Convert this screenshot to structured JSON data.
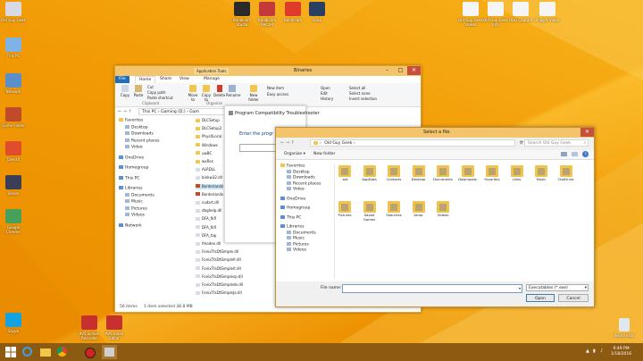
{
  "desktop_icons_left": [
    {
      "label": "Old Guy Geek",
      "color": "#d9d9e6"
    },
    {
      "label": "This PC",
      "color": "#7fb2e5"
    },
    {
      "label": "Network",
      "color": "#5a8fc7"
    },
    {
      "label": "Game Folder",
      "color": "#c04a2a"
    },
    {
      "label": "DirectX",
      "color": "#e04c2c"
    },
    {
      "label": "Steam",
      "color": "#3a3f55"
    },
    {
      "label": "Google Chrome",
      "color": "#47a15a"
    },
    {
      "label": "Skype",
      "color": "#14a3e0"
    }
  ],
  "desktop_icons_top": [
    {
      "label": "Bandicam Studio",
      "color": "#2a2a2a"
    },
    {
      "label": "Bandicam Record",
      "color": "#c43a3a"
    },
    {
      "label": "Bandicam",
      "color": "#e03a2a"
    },
    {
      "label": "Snap",
      "color": "#2a4060"
    },
    {
      "label": "Old Guy Geek Videos",
      "color": "#f5f5f5"
    },
    {
      "label": "Old Guy Geek Info",
      "color": "#f5f5f5"
    },
    {
      "label": "OGG Capture",
      "color": "#f5f5f5"
    },
    {
      "label": "Snag-it Video",
      "color": "#f5f5f5"
    }
  ],
  "desktop_icons_bottom": [
    {
      "label": "AVS Screen Recorder",
      "color": "#c83030"
    },
    {
      "label": "AVS Video Editor",
      "color": "#c83030"
    }
  ],
  "recycle_bin": "Recycle Bin",
  "explorer": {
    "title": "Binaries",
    "app_tools_tab": "Application Tools",
    "tabs": [
      "File",
      "Home",
      "Share",
      "View",
      "Manage"
    ],
    "ribbon_buttons": [
      "Copy",
      "Paste",
      "Cut",
      "Copy path",
      "Paste shortcut",
      "Move to",
      "Copy to",
      "Delete",
      "Rename",
      "New folder",
      "New item",
      "Easy access",
      "Open",
      "Edit",
      "History",
      "Select all",
      "Select none",
      "Invert selection"
    ],
    "groups": [
      "Clipboard",
      "Organize"
    ],
    "address": "This PC › Gaming (D:) › Gam",
    "nav": [
      {
        "label": "Favorites",
        "type": "star"
      },
      {
        "label": "Desktop",
        "type": "item"
      },
      {
        "label": "Downloads",
        "type": "item"
      },
      {
        "label": "Recent places",
        "type": "item"
      },
      {
        "label": "Video",
        "type": "item"
      },
      {
        "label": "OneDrive",
        "type": "head"
      },
      {
        "label": "Homegroup",
        "type": "head"
      },
      {
        "label": "This PC",
        "type": "head"
      },
      {
        "label": "Libraries",
        "type": "head"
      },
      {
        "label": "Documents",
        "type": "item"
      },
      {
        "label": "Music",
        "type": "item"
      },
      {
        "label": "Pictures",
        "type": "item"
      },
      {
        "label": "Videos",
        "type": "item"
      },
      {
        "label": "Network",
        "type": "head"
      }
    ],
    "files": [
      "DLCSetup",
      "DLCSetup2",
      "PhysXLocal",
      "Windows",
      "uwBC",
      "wxRes",
      "ALRDLL",
      "binkw32.dll",
      "Borderlands",
      "Borderlands",
      "cudart.dll",
      "dbghelp.dll",
      "DFA_fkfl",
      "DFA_fkfl",
      "DFA_top",
      "fmodex.dll",
      "FonixTtsDtSimple.dll",
      "FonixTtsDtSimplefr.dll",
      "FonixTtsDtSimpleit.dll",
      "FonixTtsDtSimplesp.dll",
      "FonixTtsDtSimplede.dll",
      "FonixTtsDtSimpleJa.dll"
    ],
    "status_items": "56 items",
    "status_selected": "1 item selected  38.8 MB"
  },
  "troubleshooter": {
    "title": "Program Compatibility Troubleshooter",
    "prompt": "Enter the progr"
  },
  "file_dialog": {
    "title": "Select a file.",
    "breadcrumb": "Old Guy Geek",
    "search_placeholder": "Search Old Guy Geek",
    "organize": "Organize ▾",
    "new_folder": "New folder",
    "nav": [
      {
        "label": "Favorites",
        "type": "star"
      },
      {
        "label": "Desktop",
        "type": "item"
      },
      {
        "label": "Downloads",
        "type": "item"
      },
      {
        "label": "Recent places",
        "type": "item"
      },
      {
        "label": "Video",
        "type": "item"
      },
      {
        "label": "OneDrive",
        "type": "head"
      },
      {
        "label": "Homegroup",
        "type": "head"
      },
      {
        "label": "This PC",
        "type": "head"
      },
      {
        "label": "Libraries",
        "type": "head"
      },
      {
        "label": "Documents",
        "type": "item"
      },
      {
        "label": "Music",
        "type": "item"
      },
      {
        "label": "Pictures",
        "type": "item"
      },
      {
        "label": "Videos",
        "type": "item"
      }
    ],
    "folders": [
      ".avt",
      "AppData",
      "Contacts",
      "Desktop",
      "Documents",
      "Downloads",
      "Favorites",
      "Links",
      "Music",
      "OneDrive",
      "Pictures",
      "Saved Games",
      "Searches",
      "temp",
      "Videos"
    ],
    "file_name_label": "File name:",
    "file_type": "Executables (*.exe)",
    "open": "Open",
    "cancel": "Cancel"
  },
  "taskbar": {
    "time": "9:49 PM",
    "date": "1/18/2016"
  }
}
